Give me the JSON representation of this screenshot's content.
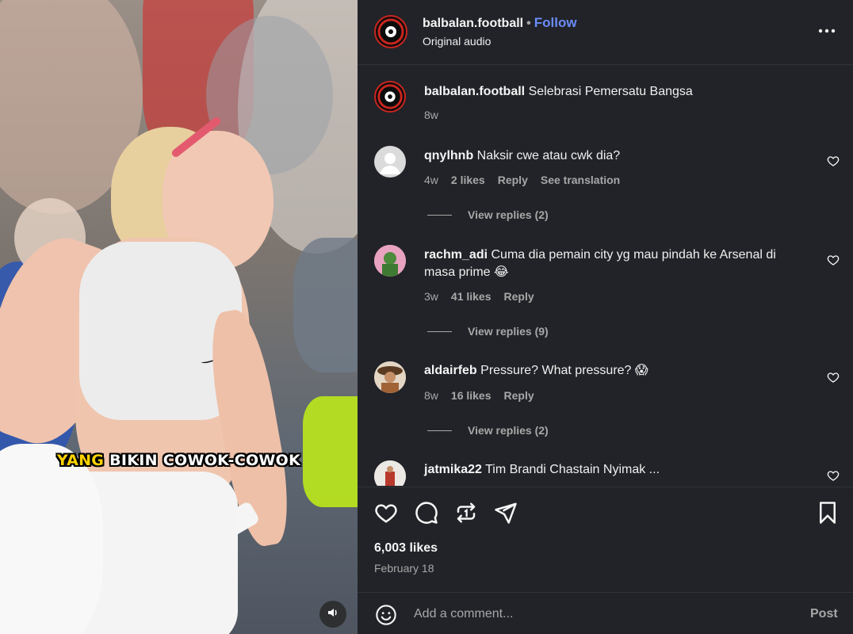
{
  "media": {
    "caption_highlight": "YANG",
    "caption_rest": " BIKIN COWOK-COWOK",
    "mute_icon": "speaker-icon"
  },
  "header": {
    "username": "balbalan.football",
    "separator": "•",
    "follow_label": "Follow",
    "subtitle": "Original audio",
    "more_icon": "more-dots-icon"
  },
  "post_caption": {
    "username": "balbalan.football",
    "text": "Selebrasi Pemersatu Bangsa",
    "time": "8w"
  },
  "comments": [
    {
      "username": "qnylhnb",
      "text": "Naksir cwe atau cwk dia?",
      "time": "4w",
      "likes": "2 likes",
      "reply": "Reply",
      "translate": "See translation",
      "view_replies": "View replies (2)"
    },
    {
      "username": "rachm_adi",
      "text": "Cuma dia pemain city yg mau pindah ke Arsenal di masa prime 😂",
      "time": "3w",
      "likes": "41 likes",
      "reply": "Reply",
      "view_replies": "View replies (9)"
    },
    {
      "username": "aldairfeb",
      "text": "Pressure? What pressure? 😱",
      "time": "8w",
      "likes": "16 likes",
      "reply": "Reply",
      "view_replies": "View replies (2)"
    },
    {
      "username": "jatmika22",
      "text": "Tim Brandi Chastain Nyimak ..."
    }
  ],
  "actions": {
    "likes": "6,003 likes",
    "date": "February 18",
    "icons": [
      "heart-icon",
      "comment-icon",
      "repost-icon",
      "share-icon",
      "save-icon"
    ]
  },
  "add_comment": {
    "placeholder": "Add a comment...",
    "post_label": "Post"
  },
  "colors": {
    "panel_bg": "#212328",
    "follow": "#6b8cf7",
    "muted_text": "#a8a8a8",
    "caption_highlight": "#ffd400"
  }
}
